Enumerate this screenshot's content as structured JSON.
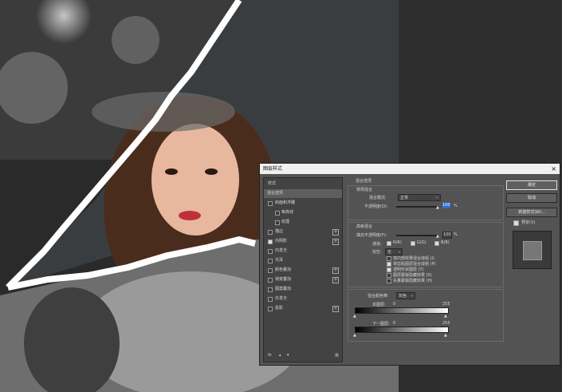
{
  "dialog": {
    "title": "图层样式",
    "close_glyph": "×",
    "styles_header": "样式",
    "style_items": [
      {
        "label": "混合选项",
        "checkbox": false,
        "checked": false,
        "plus": false,
        "active": true
      },
      {
        "label": "斜面和浮雕",
        "checkbox": true,
        "checked": false,
        "plus": false
      },
      {
        "label": "等高线",
        "checkbox": true,
        "checked": false,
        "plus": false,
        "indent": true
      },
      {
        "label": "纹理",
        "checkbox": true,
        "checked": false,
        "plus": false,
        "indent": true
      },
      {
        "label": "描边",
        "checkbox": true,
        "checked": false,
        "plus": true
      },
      {
        "label": "内阴影",
        "checkbox": true,
        "checked": true,
        "plus": true
      },
      {
        "label": "内发光",
        "checkbox": true,
        "checked": false,
        "plus": false
      },
      {
        "label": "光泽",
        "checkbox": true,
        "checked": false,
        "plus": false
      },
      {
        "label": "颜色叠加",
        "checkbox": true,
        "checked": false,
        "plus": true
      },
      {
        "label": "渐变叠加",
        "checkbox": true,
        "checked": false,
        "plus": true
      },
      {
        "label": "图案叠加",
        "checkbox": true,
        "checked": false,
        "plus": false
      },
      {
        "label": "外发光",
        "checkbox": true,
        "checked": false,
        "plus": false
      },
      {
        "label": "投影",
        "checkbox": true,
        "checked": false,
        "plus": true
      }
    ],
    "fx_label": "fx",
    "blend": {
      "section_title": "混合选项",
      "general_title": "常规混合",
      "mode_label": "混合模式:",
      "mode_value": "正常",
      "opacity_label": "不透明度(O):",
      "opacity_value": "100",
      "percent": "%",
      "advanced_title": "高级混合",
      "fill_label": "填充不透明度(F):",
      "fill_value": "100",
      "channels_label": "通道:",
      "channels": [
        "R(R)",
        "G(G)",
        "B(B)"
      ],
      "knockout_label": "挖空:",
      "knockout_value": "无",
      "options": [
        {
          "label": "将内部效果混合成组 (I)",
          "checked": false
        },
        {
          "label": "将剪贴图层混合成组 (P)",
          "checked": true
        },
        {
          "label": "透明形状图层 (T)",
          "checked": true
        },
        {
          "label": "图层蒙版隐藏效果 (S)",
          "checked": false
        },
        {
          "label": "矢量蒙版隐藏效果 (H)",
          "checked": false
        }
      ],
      "blend_if_label": "混合颜色带:",
      "blend_if_value": "灰色",
      "this_layer_label": "本图层:",
      "underlying_label": "下一图层:",
      "range_low": "0",
      "range_high": "255"
    },
    "buttons": {
      "ok": "确定",
      "cancel": "取消",
      "new_style": "新建样式(W)...",
      "preview": "预览(V)"
    }
  }
}
